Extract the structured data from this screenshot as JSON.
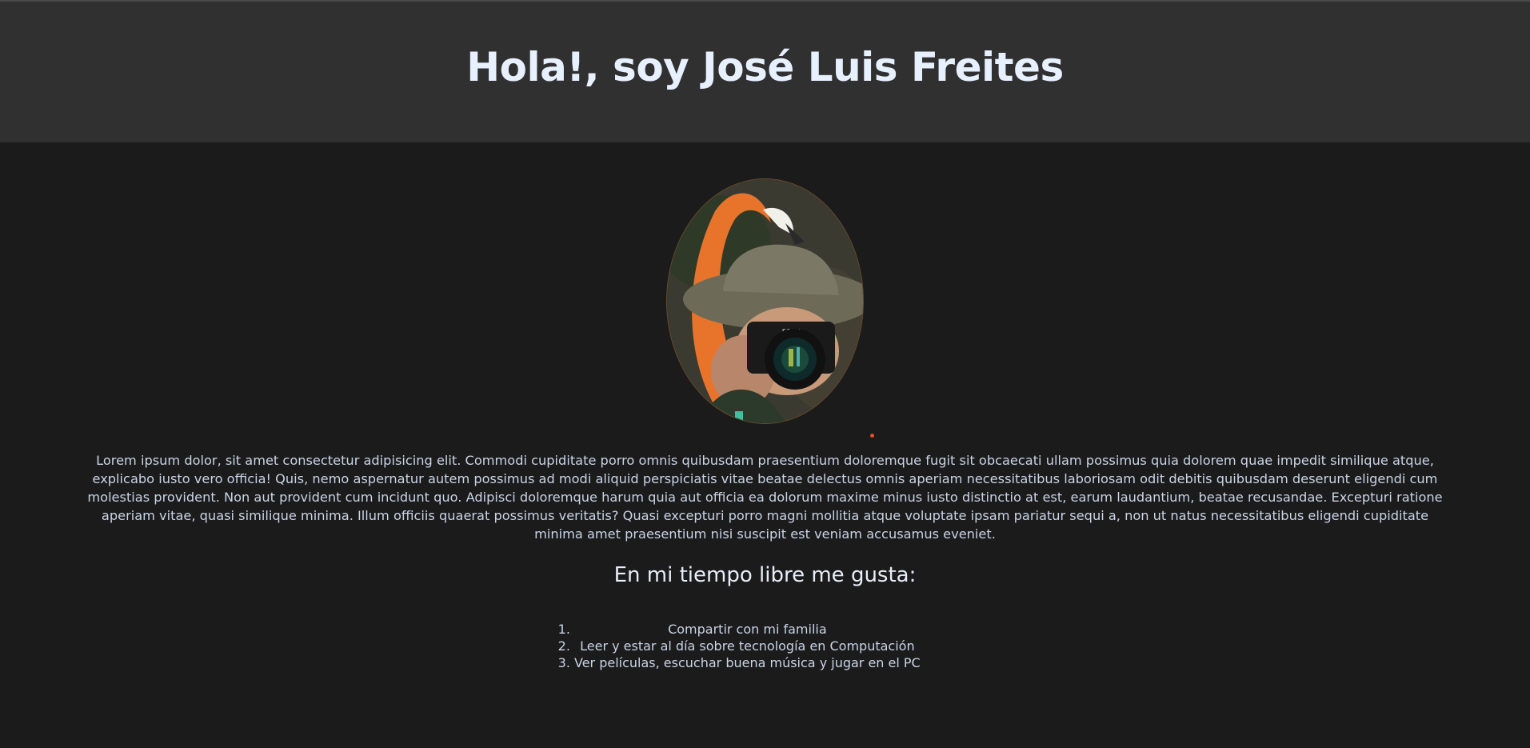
{
  "header": {
    "title": "Hola!, soy José Luis Freites"
  },
  "main": {
    "photo_alt": "Fotografía de José Luis con cámara y flamenco",
    "intro": "Lorem ipsum dolor, sit amet consectetur adipisicing elit. Commodi cupiditate porro omnis quibusdam praesentium doloremque fugit sit obcaecati ullam possimus quia dolorem quae impedit similique atque, explicabo iusto vero officia! Quis, nemo aspernatur autem possimus ad modi aliquid perspiciatis vitae beatae delectus omnis aperiam necessitatibus laboriosam odit debitis quibusdam deserunt eligendi cum molestias provident. Non aut provident cum incidunt quo. Adipisci doloremque harum quia aut officia ea dolorum maxime minus iusto distinctio at est, earum laudantium, beatae recusandae. Excepturi ratione aperiam vitae, quasi similique minima. Illum officiis quaerat possimus veritatis? Quasi excepturi porro magni mollitia atque voluptate ipsam pariatur sequi a, non ut natus necessitatibus eligendi cupiditate minima amet praesentium nisi suscipit est veniam accusamus eveniet.",
    "subtitle": "En mi tiempo libre me gusta:",
    "hobbies": [
      "Compartir con mi familia",
      "Leer y estar al día sobre tecnología en Computación",
      "Ver películas, escuchar buena música y jugar en el PC"
    ]
  },
  "colors": {
    "background": "#1b1b1b",
    "header_bg": "#303030",
    "title": "#e6f0ff",
    "text": "#c9d4e6",
    "accent_dot": "#e0502a"
  }
}
